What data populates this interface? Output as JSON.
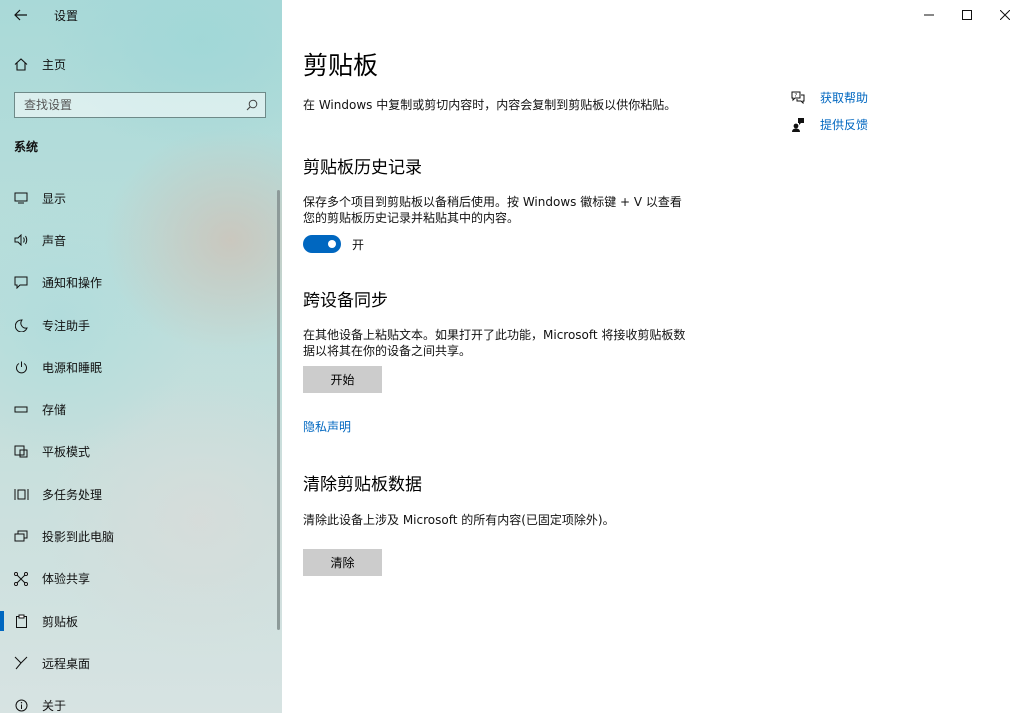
{
  "app": {
    "title": "设置"
  },
  "sidebar": {
    "home_label": "主页",
    "search_placeholder": "查找设置",
    "section_title": "系统",
    "items": [
      {
        "label": "显示",
        "icon": "display-icon"
      },
      {
        "label": "声音",
        "icon": "sound-icon"
      },
      {
        "label": "通知和操作",
        "icon": "notification-icon"
      },
      {
        "label": "专注助手",
        "icon": "moon-icon"
      },
      {
        "label": "电源和睡眠",
        "icon": "power-icon"
      },
      {
        "label": "存储",
        "icon": "storage-icon"
      },
      {
        "label": "平板模式",
        "icon": "tablet-icon"
      },
      {
        "label": "多任务处理",
        "icon": "multitask-icon"
      },
      {
        "label": "投影到此电脑",
        "icon": "project-icon"
      },
      {
        "label": "体验共享",
        "icon": "share-icon"
      },
      {
        "label": "剪贴板",
        "icon": "clipboard-icon",
        "active": true
      },
      {
        "label": "远程桌面",
        "icon": "remote-desktop-icon"
      },
      {
        "label": "关于",
        "icon": "info-icon"
      }
    ]
  },
  "main": {
    "title": "剪贴板",
    "intro": "在 Windows 中复制或剪切内容时，内容会复制到剪贴板以供你粘贴。",
    "history": {
      "heading": "剪贴板历史记录",
      "desc_line1": "保存多个项目到剪贴板以备稍后使用。按 Windows 徽标键 + V 以查看",
      "desc_line2": "您的剪贴板历史记录并粘贴其中的内容。",
      "toggle_state": "开"
    },
    "sync": {
      "heading": "跨设备同步",
      "desc_line1": "在其他设备上粘贴文本。如果打开了此功能，Microsoft 将接收剪贴板数",
      "desc_line2": "据以将其在你的设备之间共享。",
      "button_label": "开始"
    },
    "privacy_link": "隐私声明",
    "clear": {
      "heading": "清除剪贴板数据",
      "desc": "清除此设备上涉及 Microsoft 的所有内容(已固定项除外)。",
      "button_label": "清除"
    },
    "help": {
      "get_help": "获取帮助",
      "feedback": "提供反馈"
    }
  },
  "colors": {
    "accent": "#0067c0",
    "button_bg": "#cccccc"
  }
}
